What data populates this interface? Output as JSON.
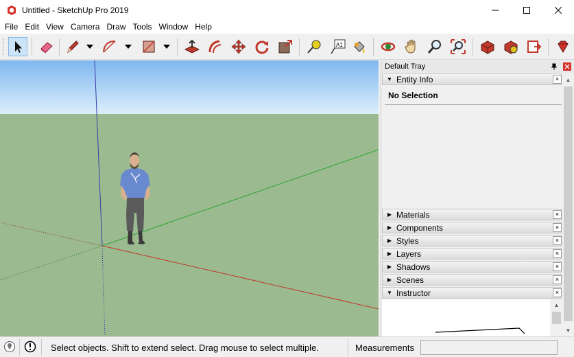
{
  "window": {
    "title": "Untitled - SketchUp Pro 2019",
    "app_icon": "sketchup-logo-icon",
    "controls": [
      "minimize-icon",
      "maximize-icon",
      "close-icon"
    ]
  },
  "menu": {
    "items": [
      "File",
      "Edit",
      "View",
      "Camera",
      "Draw",
      "Tools",
      "Window",
      "Help"
    ]
  },
  "toolbar": {
    "tools": [
      {
        "name": "select-tool",
        "icon": "arrow-cursor-icon",
        "active": true
      },
      {
        "name": "eraser-tool",
        "icon": "eraser-icon"
      },
      {
        "name": "line-tool",
        "icon": "pencil-icon",
        "dropdown": true
      },
      {
        "name": "arc-tool",
        "icon": "arc-icon",
        "dropdown": true
      },
      {
        "name": "rectangle-tool",
        "icon": "rectangle-icon",
        "dropdown": true
      },
      {
        "name": "push-pull-tool",
        "icon": "push-pull-icon"
      },
      {
        "name": "offset-tool",
        "icon": "offset-icon"
      },
      {
        "name": "move-tool",
        "icon": "move-icon"
      },
      {
        "name": "rotate-tool",
        "icon": "rotate-icon"
      },
      {
        "name": "scale-tool",
        "icon": "scale-icon"
      },
      {
        "name": "tape-measure-tool",
        "icon": "tape-measure-icon"
      },
      {
        "name": "text-tool",
        "icon": "text-label-icon"
      },
      {
        "name": "paint-bucket-tool",
        "icon": "paint-bucket-icon"
      },
      {
        "name": "orbit-tool",
        "icon": "orbit-icon"
      },
      {
        "name": "pan-tool",
        "icon": "hand-icon"
      },
      {
        "name": "zoom-tool",
        "icon": "magnifier-icon"
      },
      {
        "name": "zoom-extents-tool",
        "icon": "zoom-extents-icon"
      },
      {
        "name": "3d-warehouse",
        "icon": "warehouse-icon"
      },
      {
        "name": "extension-warehouse",
        "icon": "extension-warehouse-icon"
      },
      {
        "name": "layout-send",
        "icon": "layout-icon"
      },
      {
        "name": "extension-manager",
        "icon": "ruby-gem-icon"
      }
    ],
    "text_tool_label": "A1"
  },
  "tray": {
    "title": "Default Tray",
    "pin_icon": "pin-icon",
    "close_icon": "close-icon",
    "entity_info": {
      "label": "Entity Info",
      "expanded": true,
      "selection_text": "No Selection"
    },
    "panels": [
      {
        "label": "Materials",
        "expanded": false
      },
      {
        "label": "Components",
        "expanded": false
      },
      {
        "label": "Styles",
        "expanded": false
      },
      {
        "label": "Layers",
        "expanded": false
      },
      {
        "label": "Shadows",
        "expanded": false
      },
      {
        "label": "Scenes",
        "expanded": false
      },
      {
        "label": "Instructor",
        "expanded": true
      }
    ],
    "close_glyph": "×",
    "collapsed_glyph": "▶",
    "expanded_glyph": "▼"
  },
  "viewport": {
    "sky_top_color": "#7fb8ef",
    "sky_bottom_color": "#dceefb",
    "ground_color": "#9bba90",
    "axis_red": "#c0392b",
    "axis_green": "#2ea32e",
    "axis_blue": "#3a3aa8",
    "figure": "scale-figure-person"
  },
  "status": {
    "geo_icon": "geolocation-icon",
    "info_icon": "info-icon",
    "message": "Select objects. Shift to extend select. Drag mouse to select multiple.",
    "measurements_label": "Measurements",
    "measurements_value": ""
  }
}
